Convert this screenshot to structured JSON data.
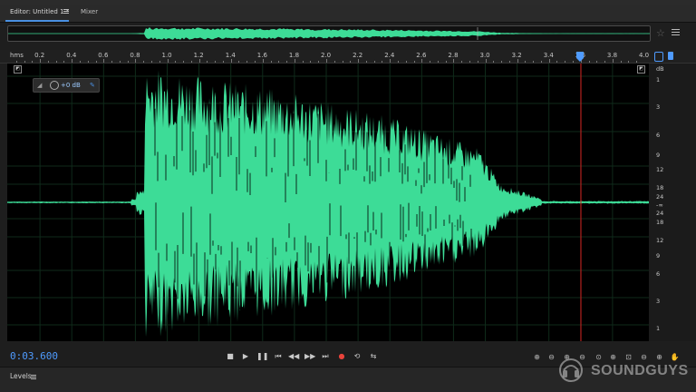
{
  "tabs": [
    {
      "label": "Editor: Untitled 1 *"
    },
    {
      "label": "Mixer"
    }
  ],
  "ruler": {
    "unit_label": "hms",
    "labels": [
      "0.2",
      "0.4",
      "0.6",
      "0.8",
      "1.0",
      "1.2",
      "1.4",
      "1.6",
      "1.8",
      "2.0",
      "2.2",
      "2.4",
      "2.6",
      "2.8",
      "3.0",
      "3.2",
      "3.4",
      "3.6",
      "3.8",
      "4.0"
    ]
  },
  "db_scale": {
    "labels": [
      "dB",
      "1",
      "3",
      "6",
      "9",
      "12",
      "18",
      "24",
      "-∞",
      "24",
      "18",
      "12",
      "9",
      "6",
      "3",
      "1"
    ]
  },
  "gain_hud": {
    "value": "+0 dB"
  },
  "transport": {
    "timecode": "0:03.600"
  },
  "levels": {
    "title": "Levels"
  },
  "watermark": {
    "brand": "SOUNDGUYS"
  },
  "colors": {
    "waveform": "#3ddc97",
    "playhead": "#d41e1e",
    "timecode": "#4f9bff",
    "background": "#000000"
  },
  "icons": [
    "menu-icon",
    "star-icon",
    "gain-knob-icon",
    "pin-icon",
    "stop-icon",
    "play-icon",
    "pause-icon",
    "go-to-start-icon",
    "rewind-icon",
    "fast-forward-icon",
    "go-to-end-icon",
    "record-icon",
    "loop-icon",
    "skip-selection-icon",
    "zoom-icons"
  ]
}
